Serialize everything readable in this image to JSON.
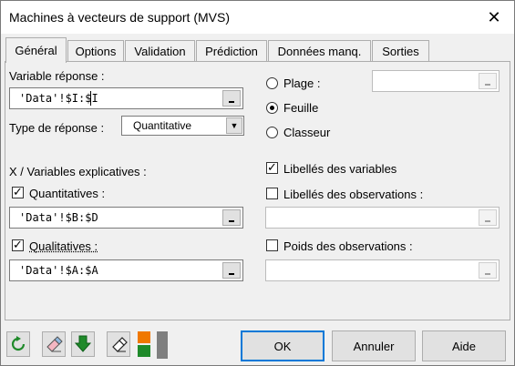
{
  "window": {
    "title": "Machines à vecteurs de support (MVS)",
    "close_glyph": "✕"
  },
  "tabs": [
    {
      "label": "Général"
    },
    {
      "label": "Options"
    },
    {
      "label": "Validation"
    },
    {
      "label": "Prédiction"
    },
    {
      "label": "Données manq."
    },
    {
      "label": "Sorties"
    }
  ],
  "general": {
    "response_variable_label": "Variable réponse :",
    "response_variable_value": "'Data'!$I:$I",
    "response_type_label": "Type de réponse :",
    "response_type_value": "Quantitative",
    "explanatory_label": "X / Variables explicatives :",
    "quantitatives_label": "Quantitatives :",
    "quantitatives_checked": true,
    "quantitatives_value": "'Data'!$B:$D",
    "qualitatives_label": "Qualitatives :",
    "qualitatives_checked": true,
    "qualitatives_value": "'Data'!$A:$A",
    "range_label": "Plage :",
    "range_value": "",
    "sheet_label": "Feuille",
    "workbook_label": "Classeur",
    "output_selected": "Feuille",
    "variable_labels_label": "Libellés des variables",
    "variable_labels_checked": true,
    "obs_labels_label": "Libellés des observations :",
    "obs_labels_checked": false,
    "obs_labels_value": "",
    "obs_weights_label": "Poids des observations :",
    "obs_weights_checked": false,
    "obs_weights_value": ""
  },
  "toolbar": {
    "icons": [
      "reset-icon",
      "eraser-icon",
      "download-arrow-icon",
      "eraser-select-icon",
      "layout-toggle-icon"
    ],
    "colors": {
      "green": "#1f8a2a",
      "orange": "#f07800",
      "gray": "#7f7f7f"
    }
  },
  "buttons": {
    "ok": "OK",
    "cancel": "Annuler",
    "help": "Aide"
  }
}
